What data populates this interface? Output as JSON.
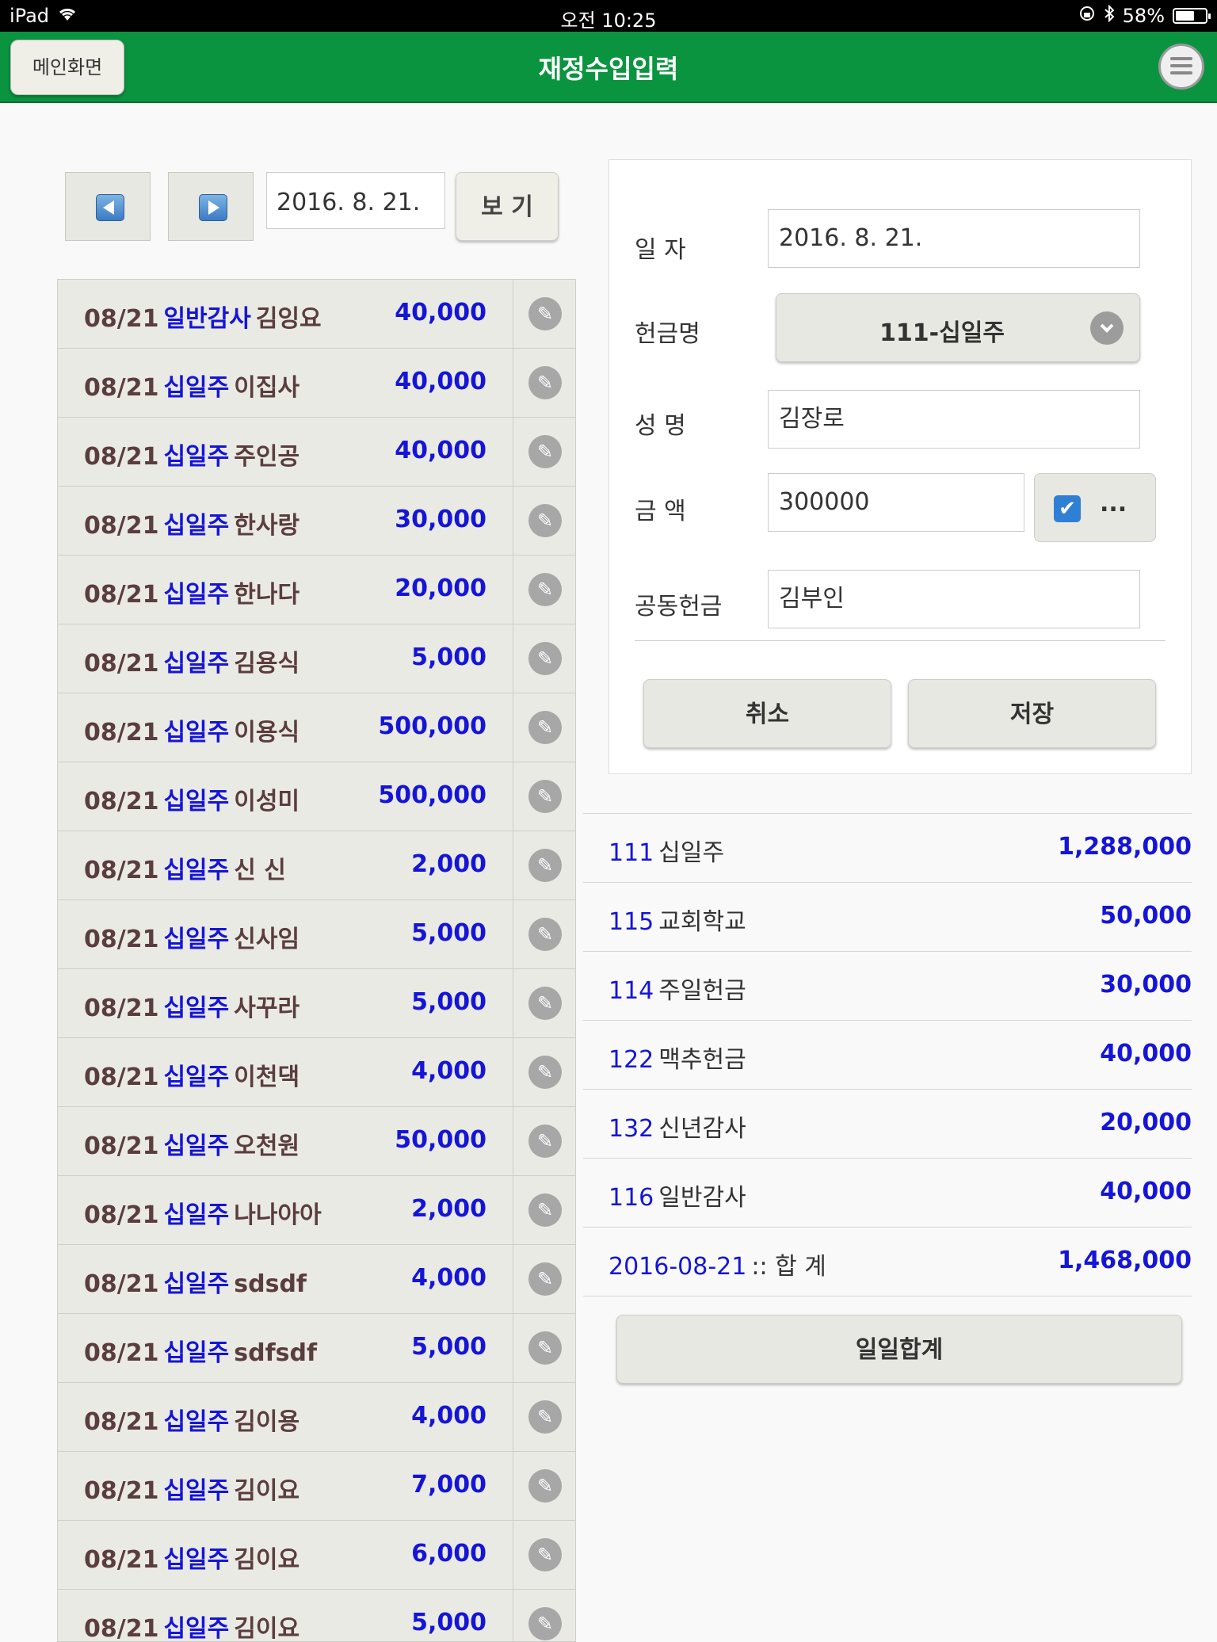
{
  "status": {
    "device": "iPad",
    "time": "오전 10:25",
    "battery": "58%"
  },
  "header": {
    "home_label": "메인화면",
    "title": "재정수입입력"
  },
  "nav": {
    "date_value": "2016. 8. 21.",
    "view_label": "보 기"
  },
  "entries": [
    {
      "date": "08/21",
      "account": "일반감사",
      "name": "김잉요",
      "amount": "40,000"
    },
    {
      "date": "08/21",
      "account": "십일주",
      "name": "이집사",
      "amount": "40,000"
    },
    {
      "date": "08/21",
      "account": "십일주",
      "name": "주인공",
      "amount": "40,000"
    },
    {
      "date": "08/21",
      "account": "십일주",
      "name": "한사랑",
      "amount": "30,000"
    },
    {
      "date": "08/21",
      "account": "십일주",
      "name": "한나다",
      "amount": "20,000"
    },
    {
      "date": "08/21",
      "account": "십일주",
      "name": "김용식",
      "amount": "5,000"
    },
    {
      "date": "08/21",
      "account": "십일주",
      "name": "이용식",
      "amount": "500,000"
    },
    {
      "date": "08/21",
      "account": "십일주",
      "name": "이성미",
      "amount": "500,000"
    },
    {
      "date": "08/21",
      "account": "십일주",
      "name": "신 신",
      "amount": "2,000"
    },
    {
      "date": "08/21",
      "account": "십일주",
      "name": "신사임",
      "amount": "5,000"
    },
    {
      "date": "08/21",
      "account": "십일주",
      "name": "사꾸라",
      "amount": "5,000"
    },
    {
      "date": "08/21",
      "account": "십일주",
      "name": "이천댁",
      "amount": "4,000"
    },
    {
      "date": "08/21",
      "account": "십일주",
      "name": "오천원",
      "amount": "50,000"
    },
    {
      "date": "08/21",
      "account": "십일주",
      "name": "나나아아",
      "amount": "2,000"
    },
    {
      "date": "08/21",
      "account": "십일주",
      "name": "sdsdf",
      "amount": "4,000"
    },
    {
      "date": "08/21",
      "account": "십일주",
      "name": "sdfsdf",
      "amount": "5,000"
    },
    {
      "date": "08/21",
      "account": "십일주",
      "name": "김이용",
      "amount": "4,000"
    },
    {
      "date": "08/21",
      "account": "십일주",
      "name": "김이요",
      "amount": "7,000"
    },
    {
      "date": "08/21",
      "account": "십일주",
      "name": "김이요",
      "amount": "6,000"
    },
    {
      "date": "08/21",
      "account": "십일주",
      "name": "김이요",
      "amount": "5,000"
    }
  ],
  "form": {
    "date_label": "일 자",
    "date_value": "2016. 8. 21.",
    "offering_label": "헌금명",
    "offering_value": "111-십일주",
    "name_label": "성 명",
    "name_value": "김장로",
    "amount_label": "금 액",
    "amount_value": "300000",
    "checkbox_checked": true,
    "more_label": "...",
    "joint_label": "공동헌금",
    "joint_value": "김부인",
    "cancel_label": "취소",
    "save_label": "저장"
  },
  "summary": [
    {
      "code": "111",
      "name": "십일주",
      "amount": "1,288,000"
    },
    {
      "code": "115",
      "name": "교회학교",
      "amount": "50,000"
    },
    {
      "code": "114",
      "name": "주일헌금",
      "amount": "30,000"
    },
    {
      "code": "122",
      "name": "맥추헌금",
      "amount": "40,000"
    },
    {
      "code": "132",
      "name": "신년감사",
      "amount": "20,000"
    },
    {
      "code": "116",
      "name": "일반감사",
      "amount": "40,000"
    },
    {
      "code": "2016-08-21",
      "name": ":: 합 계",
      "amount": "1,468,000"
    }
  ],
  "daily_total_label": "일일합계",
  "colors": {
    "header": "#0b9440",
    "accent_blue": "#1515d8",
    "text_brown": "#5a3d3d"
  }
}
